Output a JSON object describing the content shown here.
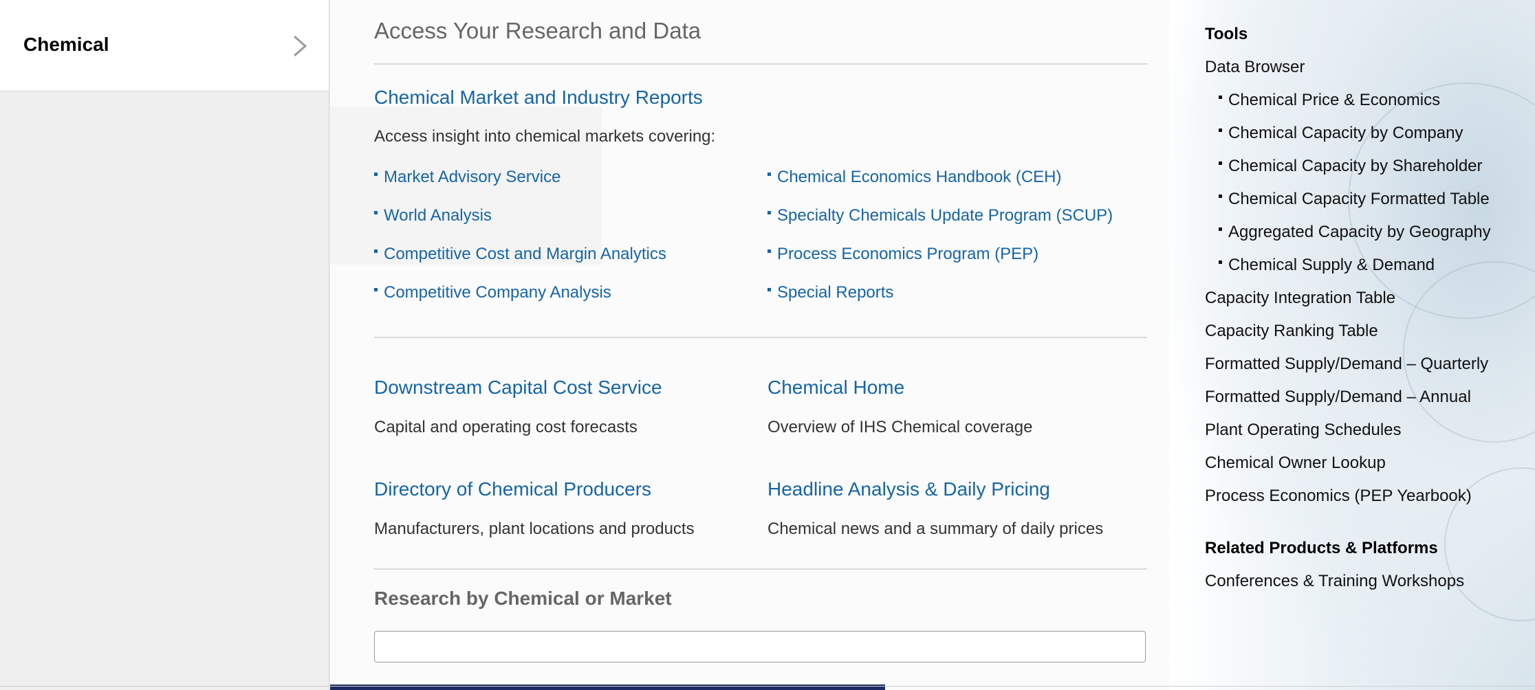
{
  "left_nav": {
    "active_item": "Chemical"
  },
  "main": {
    "heading": "Access Your Research and Data",
    "market_reports": {
      "title": "Chemical Market and Industry Reports",
      "intro": "Access insight into chemical markets covering:",
      "links_left": [
        "Market Advisory Service",
        "World Analysis",
        "Competitive Cost and Margin Analytics",
        "Competitive Company Analysis"
      ],
      "links_right": [
        "Chemical Economics Handbook (CEH)",
        "Specialty Chemicals Update Program (SCUP)",
        "Process Economics Program (PEP)",
        "Special Reports"
      ]
    },
    "services": [
      {
        "title": "Downstream Capital Cost Service",
        "desc": "Capital and operating cost forecasts"
      },
      {
        "title": "Chemical Home",
        "desc": "Overview of IHS Chemical coverage"
      },
      {
        "title": "Directory of Chemical Producers",
        "desc": "Manufacturers, plant locations and products"
      },
      {
        "title": "Headline Analysis & Daily Pricing",
        "desc": "Chemical news and a summary of daily prices"
      }
    ],
    "search": {
      "label": "Research by Chemical or Market",
      "value": "",
      "placeholder": ""
    }
  },
  "tools": {
    "heading": "Tools",
    "data_browser": "Data Browser",
    "data_browser_items": [
      "Chemical Price & Economics",
      "Chemical Capacity by Company",
      "Chemical Capacity by Shareholder",
      "Chemical Capacity Formatted Table",
      "Aggregated Capacity by Geography",
      "Chemical Supply & Demand"
    ],
    "items": [
      "Capacity Integration Table",
      "Capacity Ranking Table",
      "Formatted Supply/Demand – Quarterly",
      "Formatted Supply/Demand – Annual",
      "Plant Operating Schedules",
      "Chemical Owner Lookup",
      "Process Economics (PEP Yearbook)"
    ],
    "related_heading": "Related Products & Platforms",
    "related_items": [
      "Conferences & Training Workshops"
    ]
  },
  "colors": {
    "link": "#1565a8",
    "heading_gray": "#666666",
    "nav_bg": "#efefef",
    "bottom_strip": "#1c2a63"
  },
  "icons": {
    "nav_chevron": "chevron-right-icon"
  }
}
